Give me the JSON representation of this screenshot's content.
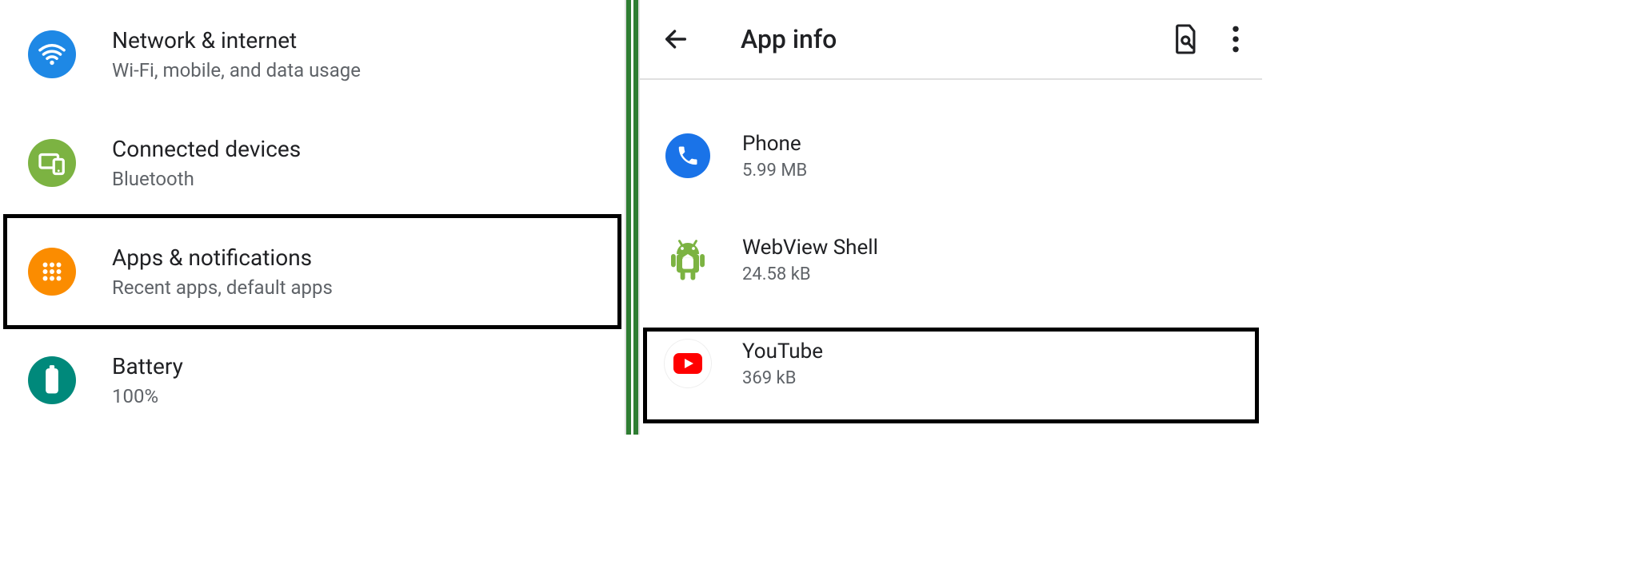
{
  "settings": {
    "items": [
      {
        "title": "Network & internet",
        "subtitle": "Wi-Fi, mobile, and data usage"
      },
      {
        "title": "Connected devices",
        "subtitle": "Bluetooth"
      },
      {
        "title": "Apps & notifications",
        "subtitle": "Recent apps, default apps"
      },
      {
        "title": "Battery",
        "subtitle": "100%"
      }
    ]
  },
  "appinfo": {
    "header_title": "App info",
    "apps": [
      {
        "name": "Phone",
        "size": "5.99 MB"
      },
      {
        "name": "WebView Shell",
        "size": "24.58 kB"
      },
      {
        "name": "YouTube",
        "size": "369 kB"
      }
    ]
  }
}
